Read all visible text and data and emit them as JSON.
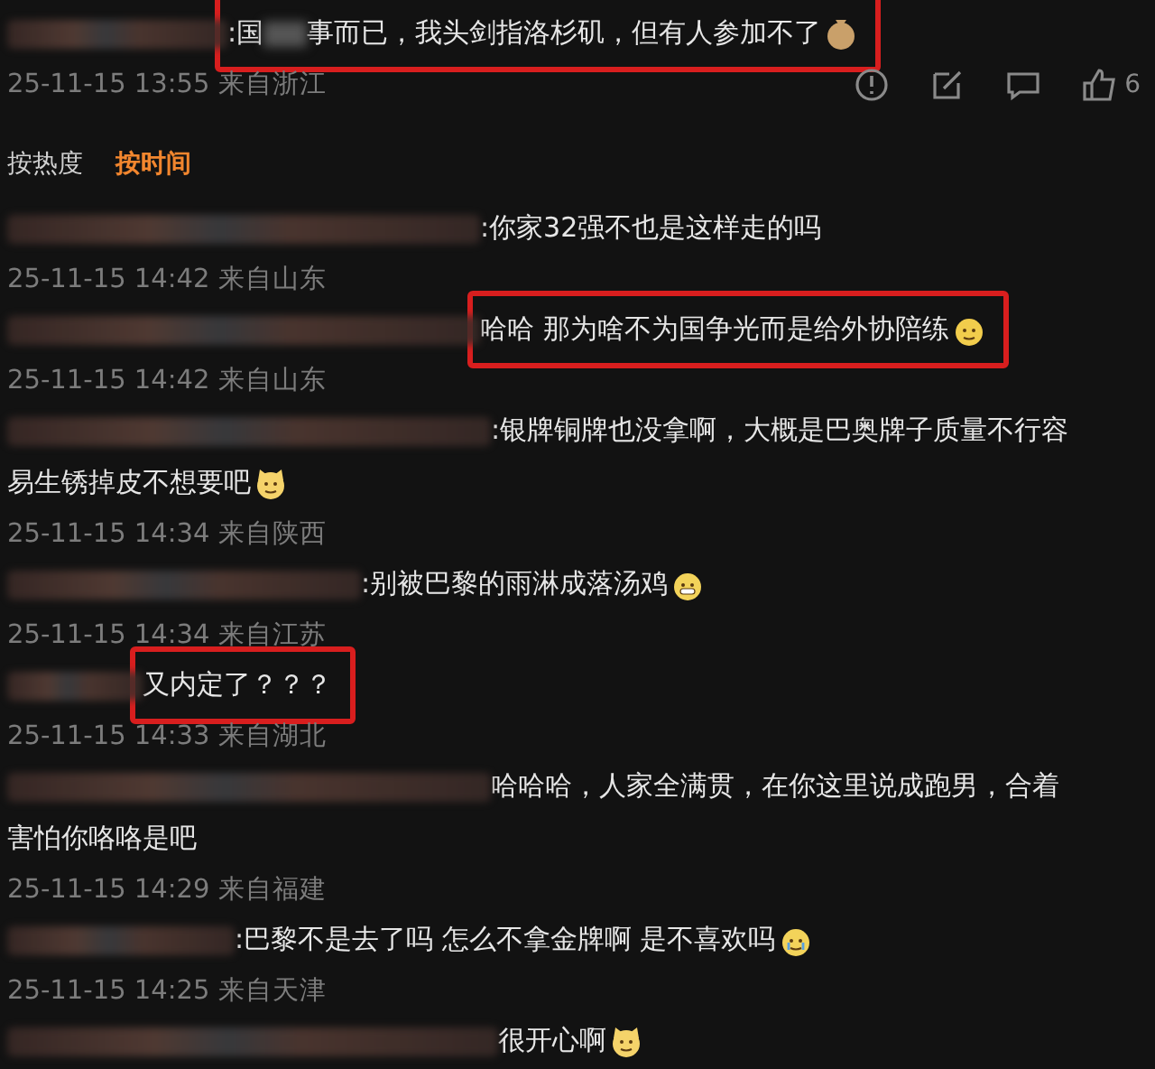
{
  "top_comment": {
    "text": [
      ":国",
      "事而已，我头剑指洛杉矶，但有人参加不了"
    ],
    "emoji": {
      "kind": "bag"
    },
    "highlighted": true,
    "meta": "25-11-15 13:55 来自浙江",
    "likes": "6"
  },
  "sort_tabs": [
    {
      "label": "按热度",
      "selected": false
    },
    {
      "label": "按时间",
      "selected": true
    }
  ],
  "replies": [
    {
      "text": [
        ":你家32强不也是这样走的吗"
      ],
      "highlighted": false,
      "meta": "25-11-15 14:42 来自山东"
    },
    {
      "text": [
        "哈哈 那为啥不为国争光而是给外协陪练"
      ],
      "emoji": {
        "kind": "face"
      },
      "highlighted": true,
      "meta": "25-11-15 14:42 来自山东"
    },
    {
      "text": [
        ":银牌铜牌也没拿啊，大概是巴奥牌子质量不行容"
      ],
      "continuation": "易生锈掉皮不想要吧",
      "emoji": {
        "kind": "cat"
      },
      "highlighted": false,
      "meta": "25-11-15 14:34 来自陕西"
    },
    {
      "text": [
        ":别被巴黎的雨淋成落汤鸡"
      ],
      "emoji": {
        "kind": "grin"
      },
      "highlighted": false,
      "meta": "25-11-15 14:34 来自江苏"
    },
    {
      "text": [
        "又内定了？？？"
      ],
      "highlighted": true,
      "meta": "25-11-15 14:33 来自湖北"
    },
    {
      "text": [
        "哈哈哈，人家全满贯，在你这里说成跑男，合着"
      ],
      "continuation": "害怕你咯咯是吧",
      "highlighted": false,
      "meta": "25-11-15 14:29 来自福建"
    },
    {
      "text": [
        ":巴黎不是去了吗 怎么不拿金牌啊 是不喜欢吗"
      ],
      "emoji": {
        "kind": "cry"
      },
      "highlighted": false,
      "meta": "25-11-15 14:25 来自天津"
    },
    {
      "text": [
        "很开心啊"
      ],
      "emoji": {
        "kind": "cat"
      },
      "highlighted": false
    }
  ]
}
